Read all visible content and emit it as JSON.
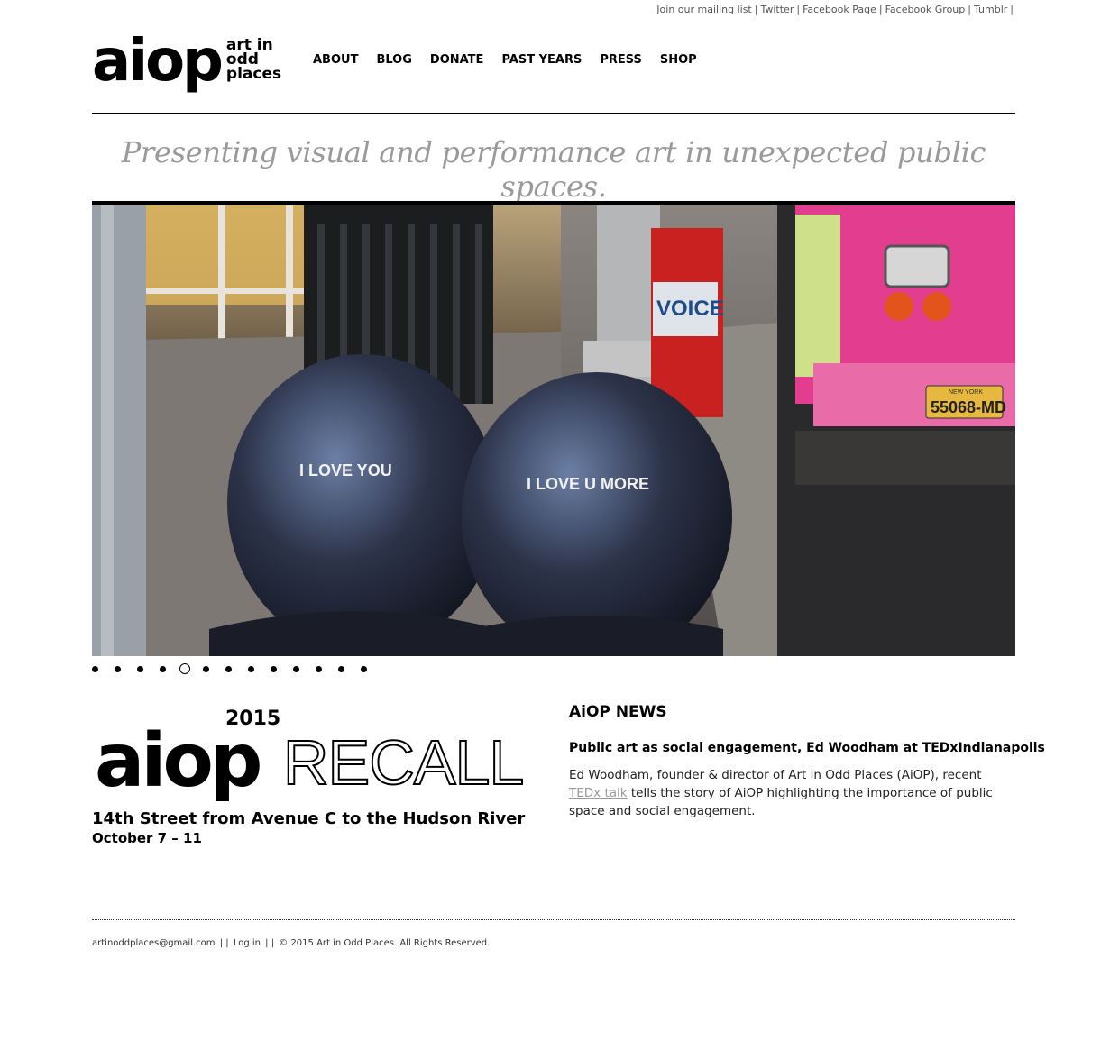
{
  "top_links": {
    "mailing": "Join our mailing list",
    "twitter": "Twitter",
    "facebook_page": "Facebook Page",
    "facebook_group": "Facebook Group",
    "tumblr": "Tumblr",
    "separator": "|"
  },
  "logo": {
    "mark": "aiop",
    "tag_line1": "art in",
    "tag_line2": "odd",
    "tag_line3": "places"
  },
  "nav": {
    "about": "ABOUT",
    "blog": "BLOG",
    "donate": "DONATE",
    "past_years": "PAST YEARS",
    "press": "PRESS",
    "shop": "SHOP"
  },
  "tagline": "Presenting visual and performance art in unexpected public spaces.",
  "hero": {
    "bag1_text": "I LOVE YOU",
    "bag2_text": "I LOVE U MORE",
    "box_text": "VOICE",
    "plate_text": "55068-MD",
    "plate_state": "NEW YORK"
  },
  "slider": {
    "count": 13,
    "active_index": 4
  },
  "recall": {
    "year": "2015",
    "aiop": "aiop",
    "word": "RECALL",
    "where": "14th Street from Avenue C to the Hudson River",
    "when": "October 7 – 11"
  },
  "news": {
    "heading": "AiOP NEWS",
    "title": "Public art as social engagement, Ed Woodham at TEDxIndianapolis",
    "body_before": "Ed Woodham, founder & director of Art in Odd Places (AiOP), recent ",
    "body_link": "TEDx talk",
    "body_after": " tells the story of AiOP highlighting the importance of public space and social engagement."
  },
  "footer": {
    "email": "artinoddplaces@gmail.com",
    "sep1": "| |",
    "login": "Log in",
    "sep2": "| |",
    "copyright": "© 2015 Art in Odd Places. All Rights Reserved."
  }
}
